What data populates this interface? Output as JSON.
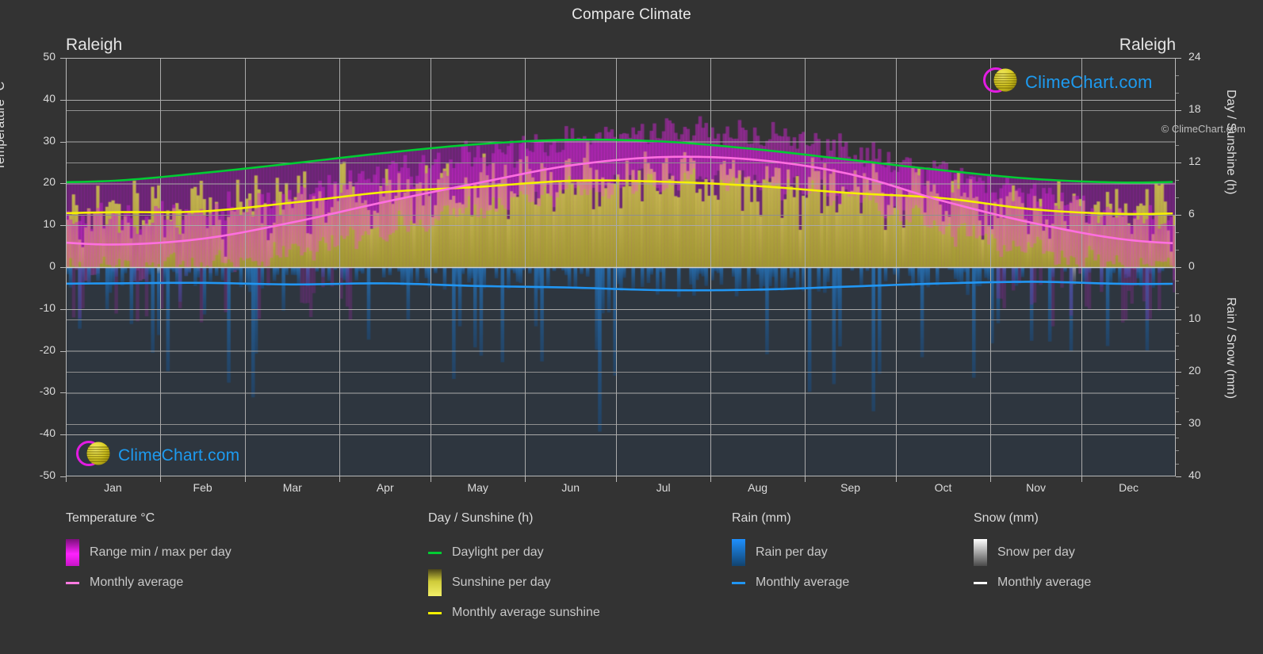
{
  "header": {
    "title": "Compare Climate",
    "left_city": "Raleigh",
    "right_city": "Raleigh"
  },
  "logo": {
    "text": "ClimeChart.com"
  },
  "footer": {
    "copyright": "© ClimeChart.com"
  },
  "axes": {
    "left_label": "Temperature °C",
    "left_ticks": [
      "50",
      "40",
      "30",
      "20",
      "10",
      "0",
      "-10",
      "-20",
      "-30",
      "-40",
      "-50"
    ],
    "right_top_label": "Day / Sunshine (h)",
    "right_top_ticks": [
      "24",
      "18",
      "12",
      "6",
      "0"
    ],
    "right_bottom_label": "Rain / Snow (mm)",
    "right_bottom_ticks": [
      "0",
      "10",
      "20",
      "30",
      "40"
    ],
    "x_ticks": [
      "Jan",
      "Feb",
      "Mar",
      "Apr",
      "May",
      "Jun",
      "Jul",
      "Aug",
      "Sep",
      "Oct",
      "Nov",
      "Dec"
    ]
  },
  "legend": {
    "groups": [
      {
        "title": "Temperature °C",
        "items": [
          {
            "label": "Range min / max per day",
            "type": "gradient",
            "color": "#ff00ff"
          },
          {
            "label": "Monthly average",
            "type": "line",
            "color": "#ff7ae0"
          }
        ]
      },
      {
        "title": "Day / Sunshine (h)",
        "items": [
          {
            "label": "Daylight per day",
            "type": "line",
            "color": "#00cc33"
          },
          {
            "label": "Sunshine per day",
            "type": "gradient",
            "color": "#efef4a"
          },
          {
            "label": "Monthly average sunshine",
            "type": "line",
            "color": "#f5f000"
          }
        ]
      },
      {
        "title": "Rain (mm)",
        "items": [
          {
            "label": "Rain per day",
            "type": "gradient",
            "color": "#1e90ff"
          },
          {
            "label": "Monthly average",
            "type": "line",
            "color": "#2196f3"
          }
        ]
      },
      {
        "title": "Snow (mm)",
        "items": [
          {
            "label": "Snow per day",
            "type": "gradient",
            "color": "#ffffff"
          },
          {
            "label": "Monthly average",
            "type": "line",
            "color": "#ffffff"
          }
        ]
      }
    ]
  },
  "colors": {
    "background": "#333333",
    "grid": "#a9a9a9",
    "text": "#d8d8d8",
    "daylight": "#00cc33",
    "sunshine_line": "#f5f000",
    "sunshine_fill": "#b3b033",
    "temp_avg": "#ff6fe0",
    "temp_range": "#cc22cc",
    "rain": "#1e6fa8",
    "rain_avg": "#2196f3",
    "snow": "#dddddd"
  },
  "chart_data": {
    "type": "area",
    "title": "Compare Climate",
    "subtitle": "Raleigh",
    "xlabel": "",
    "ylabel": "Temperature °C",
    "ylim": [
      -50,
      50
    ],
    "y2_top_label": "Day / Sunshine (h)",
    "y2_top_lim": [
      0,
      24
    ],
    "y2_bottom_label": "Rain / Snow (mm)",
    "y2_bottom_lim": [
      0,
      40
    ],
    "grid": true,
    "legend_position": "bottom",
    "categories": [
      "Jan",
      "Feb",
      "Mar",
      "Apr",
      "May",
      "Jun",
      "Jul",
      "Aug",
      "Sep",
      "Oct",
      "Nov",
      "Dec"
    ],
    "series": [
      {
        "name": "Daylight per day (h)",
        "unit": "h",
        "axis": "right-top",
        "color": "#00cc33",
        "values": [
          9.9,
          10.8,
          11.9,
          13.1,
          14.1,
          14.6,
          14.4,
          13.5,
          12.3,
          11.1,
          10.1,
          9.7
        ]
      },
      {
        "name": "Monthly average sunshine (h)",
        "unit": "h",
        "axis": "right-top",
        "color": "#f5f000",
        "values": [
          6.3,
          6.4,
          7.4,
          8.6,
          9.2,
          9.9,
          9.8,
          9.3,
          8.5,
          7.9,
          6.6,
          6.1
        ]
      },
      {
        "name": "Temperature monthly average (°C)",
        "unit": "°C",
        "axis": "left",
        "color": "#ff6fe0",
        "values": [
          5.4,
          6.8,
          10.7,
          15.6,
          20.1,
          24.3,
          26.3,
          25.6,
          22.2,
          15.8,
          10.4,
          6.5
        ]
      },
      {
        "name": "Temperature range max per day (°C)",
        "unit": "°C",
        "axis": "left",
        "color": "#cc22cc",
        "values": [
          11.2,
          13.0,
          17.4,
          22.4,
          26.4,
          30.3,
          32.1,
          31.2,
          28.1,
          22.3,
          17.2,
          12.6
        ]
      },
      {
        "name": "Temperature range min per day (°C)",
        "unit": "°C",
        "axis": "left",
        "color": "#cc22cc",
        "values": [
          -0.4,
          0.5,
          3.9,
          8.6,
          13.7,
          18.3,
          20.5,
          20.0,
          16.4,
          9.4,
          3.7,
          0.4
        ]
      },
      {
        "name": "Rain monthly average (mm)",
        "unit": "mm",
        "axis": "right-bottom",
        "color": "#2196f3",
        "values": [
          3.1,
          3.0,
          3.3,
          3.1,
          3.6,
          3.9,
          4.4,
          4.3,
          3.7,
          3.1,
          2.8,
          3.2
        ]
      },
      {
        "name": "Snow monthly average (mm)",
        "unit": "mm",
        "axis": "right-bottom",
        "color": "#ffffff",
        "values": [
          0.3,
          0.2,
          0.1,
          0.0,
          0.0,
          0.0,
          0.0,
          0.0,
          0.0,
          0.0,
          0.0,
          0.2
        ]
      }
    ]
  }
}
